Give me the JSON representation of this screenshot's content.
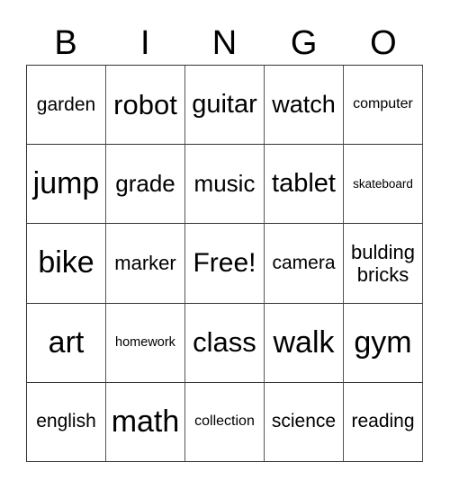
{
  "header": {
    "letters": [
      "B",
      "I",
      "N",
      "G",
      "O"
    ]
  },
  "board": {
    "rows": [
      [
        "garden",
        "robot",
        "guitar",
        "watch",
        "computer"
      ],
      [
        "jump",
        "grade",
        "music",
        "tablet",
        "skateboard"
      ],
      [
        "bike",
        "marker",
        "Free!",
        "camera",
        "bulding\nbricks"
      ],
      [
        "art",
        "homework",
        "class",
        "walk",
        "gym"
      ],
      [
        "english",
        "math",
        "collection",
        "science",
        "reading"
      ]
    ]
  }
}
